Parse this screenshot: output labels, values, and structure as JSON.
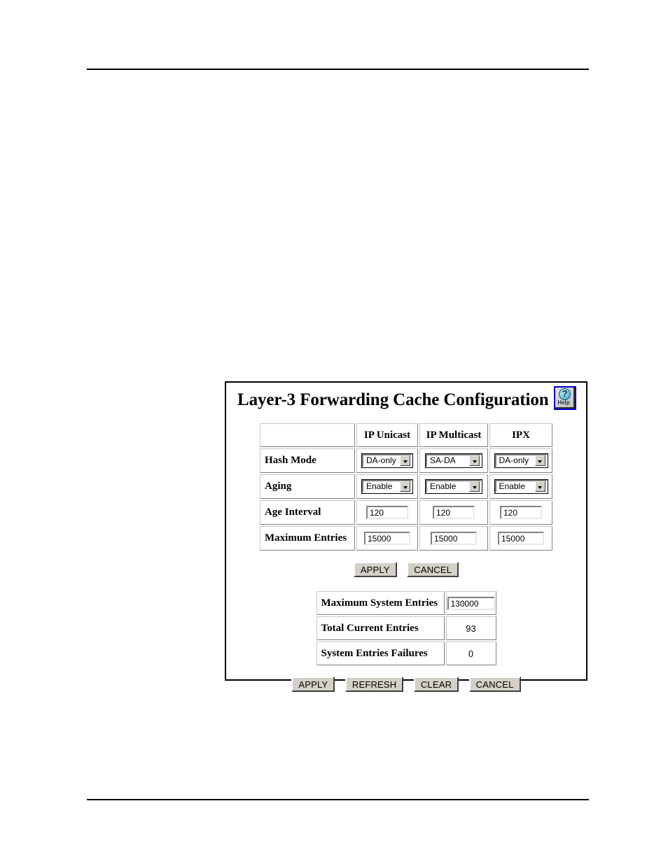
{
  "panel": {
    "title": "Layer-3 Forwarding Cache Configuration",
    "help": {
      "glyph": "?",
      "label": "Help",
      "icon_name": "help-question-icon",
      "border_color": "#0000cc"
    }
  },
  "config_table": {
    "columns": [
      "",
      "IP Unicast",
      "IP Multicast",
      "IPX"
    ],
    "rows": [
      {
        "label": "Hash Mode",
        "type": "select",
        "values": [
          "DA-only",
          "SA-DA",
          "DA-only"
        ]
      },
      {
        "label": "Aging",
        "type": "select",
        "values": [
          "Enable",
          "Enable",
          "Enable"
        ]
      },
      {
        "label": "Age Interval",
        "type": "text",
        "values": [
          "120",
          "120",
          "120"
        ]
      },
      {
        "label": "Maximum Entries",
        "type": "text",
        "values": [
          "15000",
          "15000",
          "15000"
        ]
      }
    ]
  },
  "config_buttons": [
    {
      "label": "APPLY"
    },
    {
      "label": "CANCEL"
    }
  ],
  "system_table": {
    "rows": [
      {
        "label": "Maximum System Entries",
        "value": "130000",
        "editable": true
      },
      {
        "label": "Total Current Entries",
        "value": "93",
        "editable": false
      },
      {
        "label": "System Entries Failures",
        "value": "0",
        "editable": false
      }
    ]
  },
  "system_buttons": [
    {
      "label": "APPLY"
    },
    {
      "label": "REFRESH"
    },
    {
      "label": "CLEAR"
    },
    {
      "label": "CANCEL"
    }
  ]
}
